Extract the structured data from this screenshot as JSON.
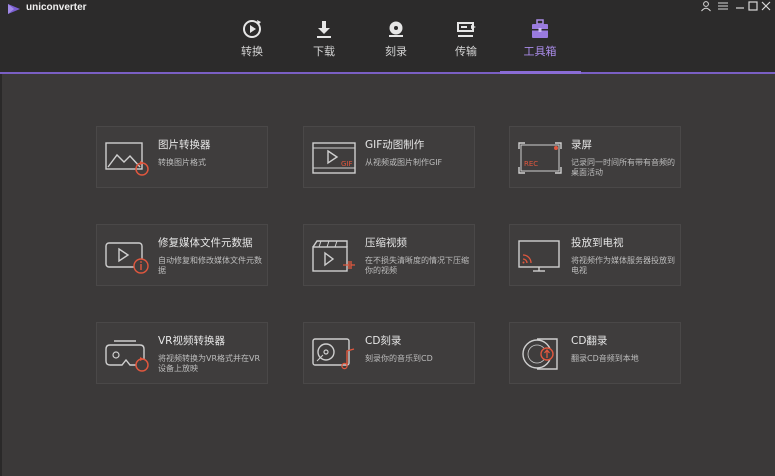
{
  "app": {
    "name": "uniconverter"
  },
  "nav": {
    "tabs": [
      {
        "label": "转换",
        "icon": "convert-icon"
      },
      {
        "label": "下载",
        "icon": "download-icon"
      },
      {
        "label": "刻录",
        "icon": "burn-icon"
      },
      {
        "label": "传输",
        "icon": "transfer-icon"
      },
      {
        "label": "工具箱",
        "icon": "toolbox-icon",
        "active": true
      }
    ]
  },
  "colors": {
    "accent": "#8a6cd6",
    "icon_orange": "#e0573e",
    "background": "#3b3939"
  },
  "tools": [
    {
      "title": "图片转换器",
      "desc": "转换图片格式",
      "icon": "image-converter-icon"
    },
    {
      "title": "GIF动图制作",
      "desc": "从视频或图片制作GIF",
      "icon": "gif-maker-icon"
    },
    {
      "title": "录屏",
      "desc": "记录同一时间所有带有音频的桌面活动",
      "icon": "screen-recorder-icon"
    },
    {
      "title": "修复媒体文件元数据",
      "desc": "自动修复和修改媒体文件元数据",
      "icon": "metadata-fix-icon"
    },
    {
      "title": "压缩视频",
      "desc": "在不损失清晰度的情况下压缩你的视频",
      "icon": "video-compress-icon"
    },
    {
      "title": "投放到电视",
      "desc": "将视频作为媒体服务器投放到电视",
      "icon": "cast-to-tv-icon"
    },
    {
      "title": "VR视频转换器",
      "desc": "将视频转换为VR格式并在VR设备上放映",
      "icon": "vr-converter-icon"
    },
    {
      "title": "CD刻录",
      "desc": "刻录你的音乐到CD",
      "icon": "cd-burner-icon"
    },
    {
      "title": "CD翻录",
      "desc": "翻录CD音频到本地",
      "icon": "cd-ripper-icon"
    }
  ]
}
